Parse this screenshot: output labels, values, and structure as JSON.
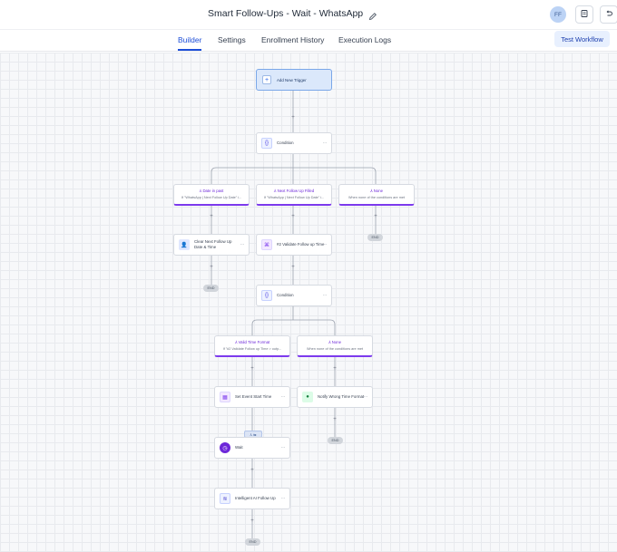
{
  "header": {
    "title": "Smart Follow-Ups - Wait - WhatsApp",
    "avatar_initials": "FF"
  },
  "tabs": [
    {
      "label": "Builder",
      "active": true
    },
    {
      "label": "Settings",
      "active": false
    },
    {
      "label": "Enrollment History",
      "active": false
    },
    {
      "label": "Execution Logs",
      "active": false
    }
  ],
  "toolbar": {
    "test_workflow_label": "Test Workflow"
  },
  "canvas": {
    "trigger": {
      "label": "Add New Trigger",
      "icon": "plus-icon"
    },
    "condition_1": {
      "label": "Condition",
      "icon": "braces-icon"
    },
    "branch_date_passed": {
      "title": "Date in past",
      "desc": "If \"WhatsApp | Next Follow Up Date\" i..."
    },
    "branch_next_follow_up_filled": {
      "title": "Next Follow Up Filled",
      "desc": "If \"WhatsApp | Next Follow Up Date\" i..."
    },
    "branch_none_1": {
      "title": "None",
      "desc": "When none of the conditions are met"
    },
    "action_clear_date": {
      "label": "Clear Next Follow Up Date & Time",
      "icon": "user-contact-icon"
    },
    "action_validate_time": {
      "label": "#2 Validate Follow up Time",
      "icon": "code-icon"
    },
    "end_label": "END",
    "condition_2": {
      "label": "Condition",
      "icon": "braces-icon"
    },
    "branch_valid_time": {
      "title": "Valid Time Format",
      "desc": "If \"#2 Validate Follow up Time > outp..."
    },
    "branch_none_2": {
      "title": "None",
      "desc": "When none of the conditions are met"
    },
    "action_set_event_start": {
      "label": "Set Event Start Time",
      "icon": "calendar-icon"
    },
    "action_notify_wrong": {
      "label": "Notify Wrong Time Format",
      "icon": "chat-icon"
    },
    "action_wait": {
      "label": "Wait",
      "icon": "clock-icon"
    },
    "action_ai_follow_up": {
      "label": "Intelligent AI Follow Up",
      "icon": "feed-icon"
    },
    "colors": {
      "accent": "#1d4ed8",
      "branch": "#7c3aed",
      "trigger_bg": "#dbe8fb"
    }
  }
}
